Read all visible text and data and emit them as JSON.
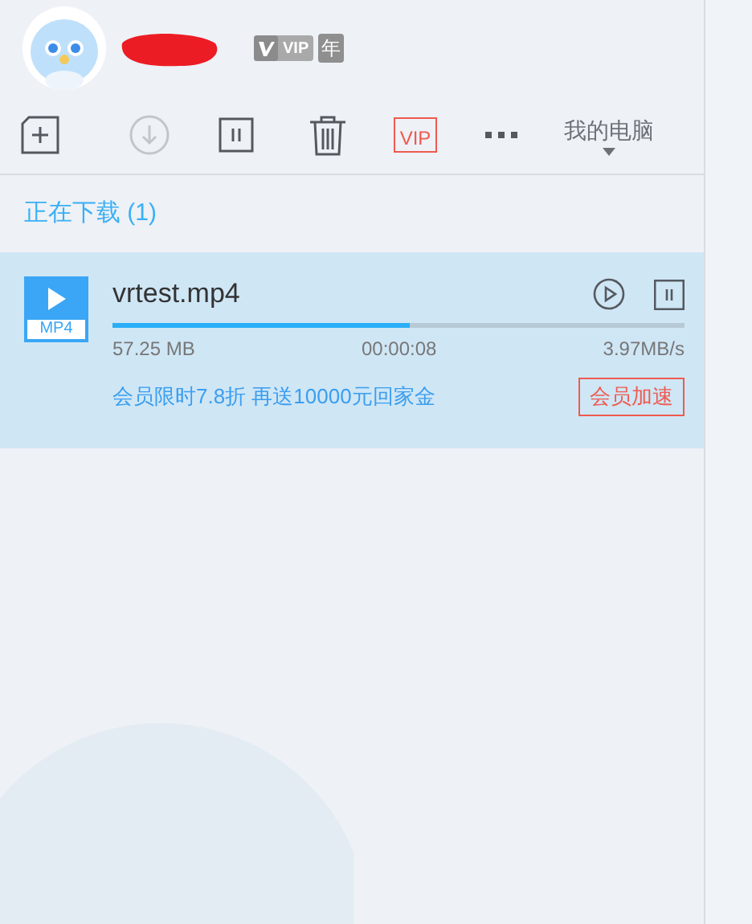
{
  "header": {
    "badges": [
      "VIP",
      "年"
    ]
  },
  "toolbar": {
    "location": "我的电脑",
    "vip_label": "VIP"
  },
  "section": {
    "title": "正在下载 (1)"
  },
  "downloads": [
    {
      "file_type": "MP4",
      "name": "vrtest.mp4",
      "level": 0.52,
      "size": "57.25 MB",
      "time": "00:00:08",
      "speed": "3.97MB/s",
      "promo": "会员限时7.8折 再送10000元回家金",
      "boost_button": "会员加速",
      "selected": true
    }
  ]
}
